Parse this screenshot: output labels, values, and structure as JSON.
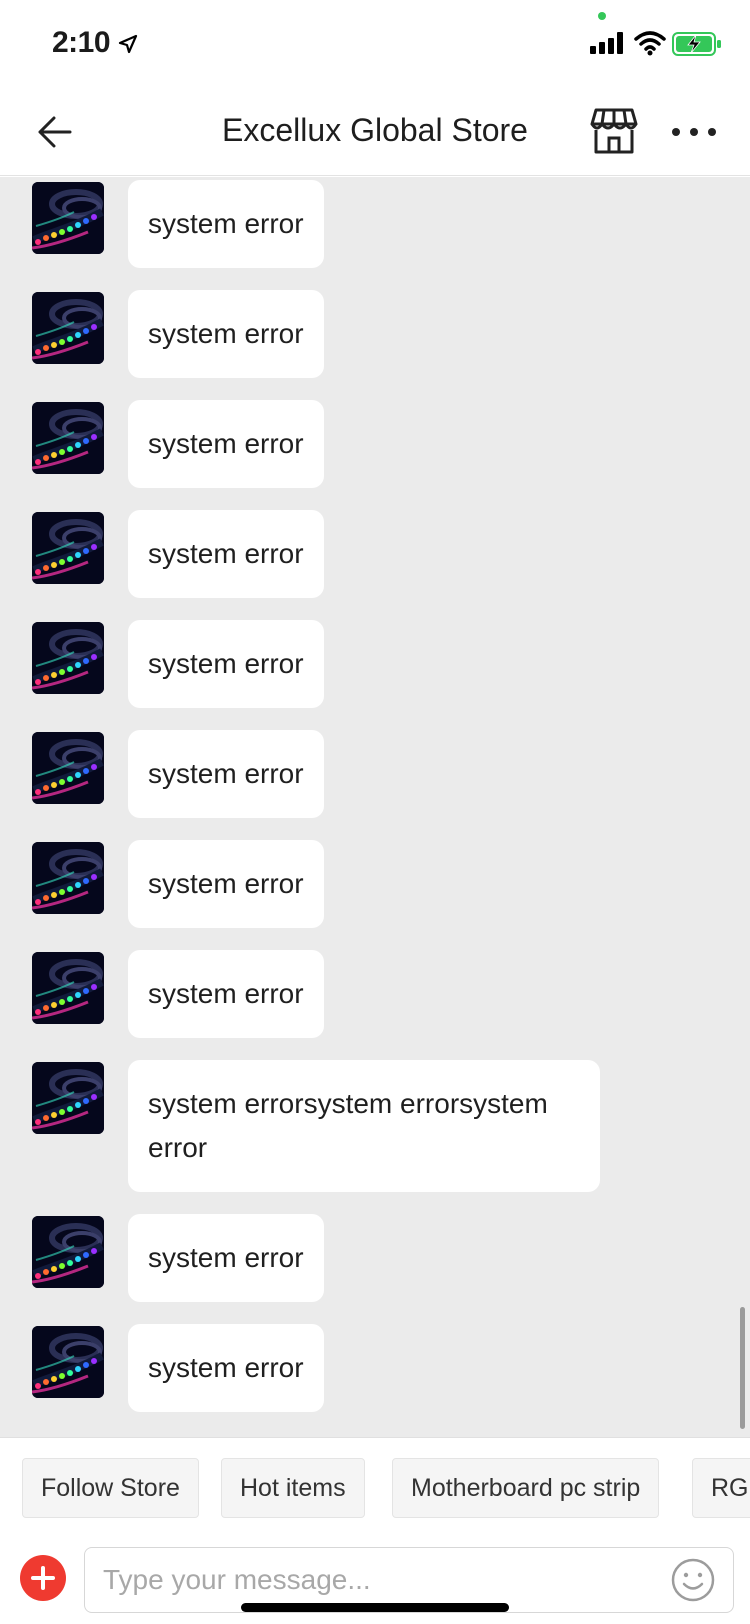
{
  "status_bar": {
    "time": "2:10",
    "icons": [
      "location-arrow-icon",
      "signal-icon",
      "wifi-icon",
      "battery-charging-icon"
    ]
  },
  "header": {
    "title": "Excellux Global Store",
    "back_icon": "back-arrow-icon",
    "store_icon": "storefront-icon",
    "more_icon": "more-dots-icon"
  },
  "messages": [
    {
      "text": "system error"
    },
    {
      "text": "system error"
    },
    {
      "text": "system error"
    },
    {
      "text": "system error"
    },
    {
      "text": "system error"
    },
    {
      "text": "system error"
    },
    {
      "text": "system error"
    },
    {
      "text": "system error"
    },
    {
      "text": "system errorsystem errorsystem error"
    },
    {
      "text": "system error"
    },
    {
      "text": "system error"
    }
  ],
  "quick_replies": [
    "Follow Store",
    "Hot items",
    "Motherboard pc strip",
    "RGB"
  ],
  "composer": {
    "placeholder": "Type your message...",
    "add_icon": "plus-circle-icon",
    "emoji_icon": "smiley-icon"
  },
  "colors": {
    "accent": "#ef3a30",
    "chat_background": "#ebebeb",
    "bubble": "#ffffff"
  }
}
